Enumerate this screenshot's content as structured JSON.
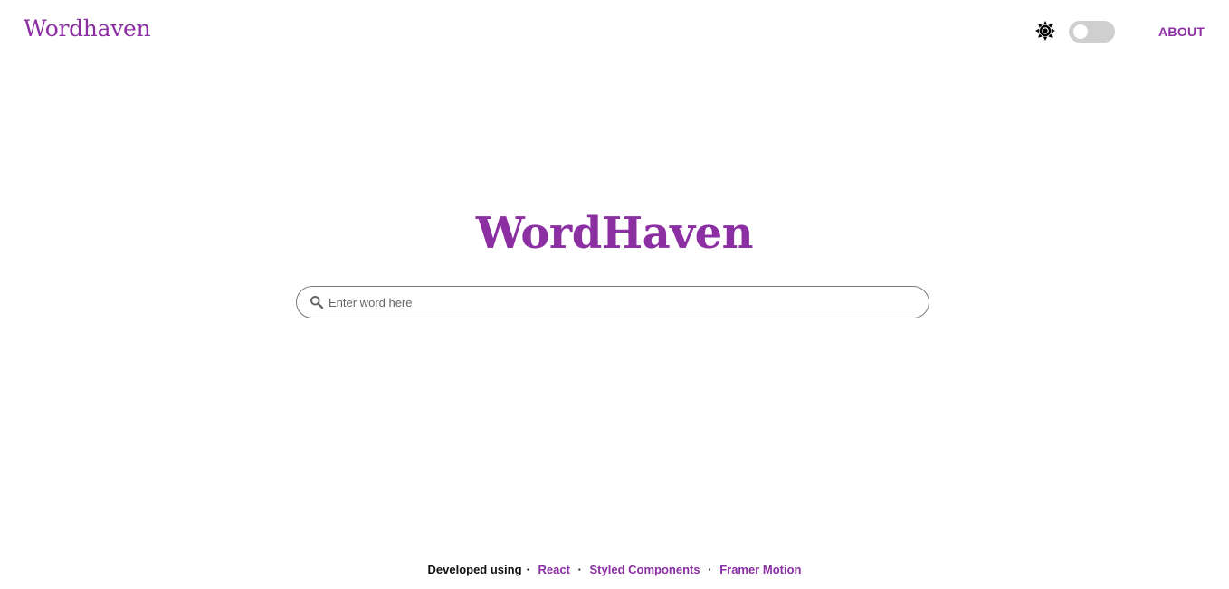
{
  "header": {
    "brand": "Wordhaven",
    "about_label": "ABOUT",
    "theme_icon": "sun-icon",
    "theme_toggle_state": "off"
  },
  "hero": {
    "title": "WordHaven"
  },
  "search": {
    "placeholder": "Enter word here",
    "value": "",
    "icon": "search-icon"
  },
  "footer": {
    "label": "Developed using",
    "separator": "·",
    "links": [
      "React",
      "Styled Components",
      "Framer Motion"
    ]
  },
  "colors": {
    "accent": "#8b2fa3",
    "toggle_track": "#cfcfcf",
    "text_dark": "#111111"
  }
}
